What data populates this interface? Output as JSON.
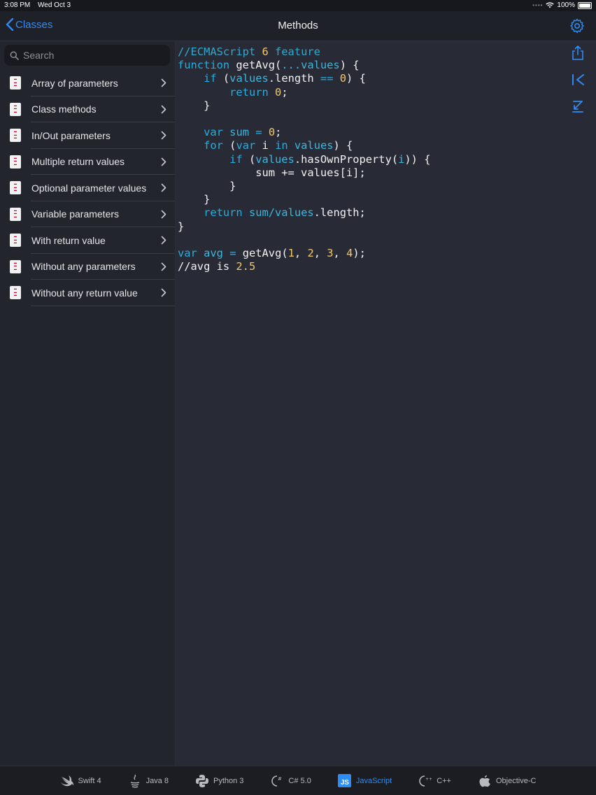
{
  "status_bar": {
    "time": "3:08 PM",
    "date": "Wed Oct 3",
    "battery": "100%"
  },
  "nav": {
    "back_label": "Classes",
    "title": "Methods"
  },
  "search": {
    "placeholder": "Search"
  },
  "methods": [
    {
      "label": "Array of parameters"
    },
    {
      "label": "Class methods"
    },
    {
      "label": "In/Out parameters"
    },
    {
      "label": "Multiple return values"
    },
    {
      "label": "Optional parameter values"
    },
    {
      "label": "Variable parameters"
    },
    {
      "label": "With return value"
    },
    {
      "label": "Without any parameters"
    },
    {
      "label": "Without any return value"
    }
  ],
  "code_lines": [
    [
      [
        "c-com",
        "//ECMAScript "
      ],
      [
        "c-num",
        "6"
      ],
      [
        "c-com",
        " feature"
      ]
    ],
    [
      [
        "c-kw",
        "function"
      ],
      [
        "c-txt",
        " getAvg("
      ],
      [
        "c-var",
        "...values"
      ],
      [
        "c-txt",
        ") {"
      ]
    ],
    [
      [
        "c-txt",
        "    "
      ],
      [
        "c-kw",
        "if"
      ],
      [
        "c-txt",
        " ("
      ],
      [
        "c-var",
        "values"
      ],
      [
        "c-txt",
        ".length "
      ],
      [
        "c-kw",
        "=="
      ],
      [
        "c-txt",
        " "
      ],
      [
        "c-num",
        "0"
      ],
      [
        "c-txt",
        ") {"
      ]
    ],
    [
      [
        "c-txt",
        "        "
      ],
      [
        "c-kw",
        "return"
      ],
      [
        "c-txt",
        " "
      ],
      [
        "c-num",
        "0"
      ],
      [
        "c-txt",
        ";"
      ]
    ],
    [
      [
        "c-txt",
        "    }"
      ]
    ],
    [
      [
        "c-txt",
        ""
      ]
    ],
    [
      [
        "c-txt",
        "    "
      ],
      [
        "c-kw",
        "var"
      ],
      [
        "c-txt",
        " "
      ],
      [
        "c-var",
        "sum"
      ],
      [
        "c-txt",
        " "
      ],
      [
        "c-kw",
        "="
      ],
      [
        "c-txt",
        " "
      ],
      [
        "c-num",
        "0"
      ],
      [
        "c-txt",
        ";"
      ]
    ],
    [
      [
        "c-txt",
        "    "
      ],
      [
        "c-kw",
        "for"
      ],
      [
        "c-txt",
        " ("
      ],
      [
        "c-kw",
        "var"
      ],
      [
        "c-txt",
        " i "
      ],
      [
        "c-kw",
        "in"
      ],
      [
        "c-txt",
        " "
      ],
      [
        "c-var",
        "values"
      ],
      [
        "c-txt",
        ") {"
      ]
    ],
    [
      [
        "c-txt",
        "        "
      ],
      [
        "c-kw",
        "if"
      ],
      [
        "c-txt",
        " ("
      ],
      [
        "c-var",
        "values"
      ],
      [
        "c-txt",
        ".hasOwnProperty("
      ],
      [
        "c-var",
        "i"
      ],
      [
        "c-txt",
        ")) {"
      ]
    ],
    [
      [
        "c-txt",
        "            sum += values[i];"
      ]
    ],
    [
      [
        "c-txt",
        "        }"
      ]
    ],
    [
      [
        "c-txt",
        "    }"
      ]
    ],
    [
      [
        "c-txt",
        "    "
      ],
      [
        "c-kw",
        "return"
      ],
      [
        "c-txt",
        " "
      ],
      [
        "c-var",
        "sum/values"
      ],
      [
        "c-txt",
        ".length;"
      ]
    ],
    [
      [
        "c-txt",
        "}"
      ]
    ],
    [
      [
        "c-txt",
        ""
      ]
    ],
    [
      [
        "c-kw",
        "var"
      ],
      [
        "c-txt",
        " "
      ],
      [
        "c-var",
        "avg"
      ],
      [
        "c-txt",
        " "
      ],
      [
        "c-kw",
        "="
      ],
      [
        "c-txt",
        " getAvg("
      ],
      [
        "c-num",
        "1"
      ],
      [
        "c-txt",
        ", "
      ],
      [
        "c-num",
        "2"
      ],
      [
        "c-txt",
        ", "
      ],
      [
        "c-num",
        "3"
      ],
      [
        "c-txt",
        ", "
      ],
      [
        "c-num",
        "4"
      ],
      [
        "c-txt",
        ");"
      ]
    ],
    [
      [
        "c-txt",
        "//avg is "
      ],
      [
        "c-num",
        "2.5"
      ]
    ]
  ],
  "tabs": [
    {
      "label": "Swift 4",
      "icon": "swift-icon",
      "active": false
    },
    {
      "label": "Java 8",
      "icon": "java-icon",
      "active": false
    },
    {
      "label": "Python 3",
      "icon": "python-icon",
      "active": false
    },
    {
      "label": "C# 5.0",
      "icon": "csharp-icon",
      "active": false
    },
    {
      "label": "JavaScript",
      "icon": "javascript-icon",
      "active": true,
      "badge": "JS"
    },
    {
      "label": "C++",
      "icon": "cpp-icon",
      "active": false
    },
    {
      "label": "Objective-C",
      "icon": "objc-icon",
      "active": false
    }
  ],
  "colors": {
    "accent": "#2f8cf5",
    "background": "#282b36",
    "sidebar": "#23252d"
  }
}
